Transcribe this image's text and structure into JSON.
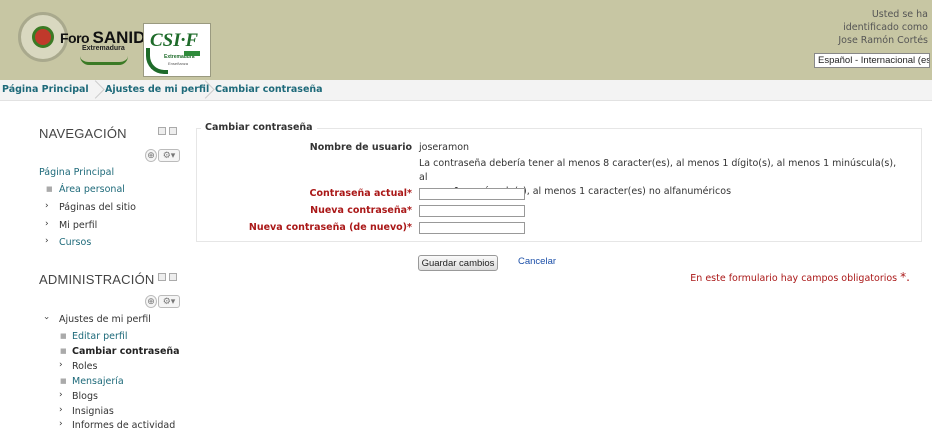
{
  "header": {
    "logo_foro": "Foro",
    "logo_sanid": "SANID",
    "logo_ext": "Extremadura",
    "csif_text": "CSI·F",
    "csif_sub": "Extremadura",
    "csif_sub2": "Enseñanza",
    "user_line1": "Usted se ha",
    "user_line2": "identificado como",
    "user_name": "Jose Ramón Cortés",
    "language": "Español - Internacional (es)"
  },
  "breadcrumb": {
    "items": [
      "Página Principal",
      "Ajustes de mi perfil",
      "Cambiar contraseña"
    ]
  },
  "navigation": {
    "title": "NAVEGACIÓN",
    "home": "Página Principal",
    "items": [
      "Área personal",
      "Páginas del sitio",
      "Mi perfil",
      "Cursos"
    ]
  },
  "administration": {
    "title": "ADMINISTRACIÓN",
    "section": "Ajustes de mi perfil",
    "items": [
      "Editar perfil",
      "Cambiar contraseña",
      "Roles",
      "Mensajería",
      "Blogs",
      "Insignias",
      "Informes de actividad"
    ]
  },
  "form": {
    "legend": "Cambiar contraseña",
    "username_label": "Nombre de usuario",
    "username_value": "joseramon",
    "policy_line1": "La contraseña debería tener al menos 8 caracter(es), al menos 1 dígito(s), al menos 1 minúscula(s), al",
    "policy_line2": "menos 1 mayúscula(s), al menos 1 caracter(es) no alfanuméricos",
    "current_label": "Contraseña actual",
    "new_label": "Nueva contraseña",
    "repeat_label": "Nueva contraseña (de nuevo)",
    "required_mark": "*",
    "save_button": "Guardar cambios",
    "cancel_link": "Cancelar",
    "required_note": "En este formulario hay campos obligatorios",
    "required_note_mark": "*."
  },
  "colors": {
    "header_bg": "#c7c6a3",
    "link": "#1e6a7a",
    "required": "#aa1818"
  }
}
